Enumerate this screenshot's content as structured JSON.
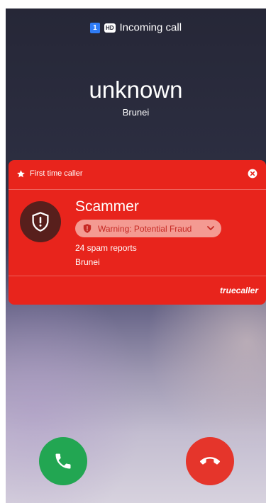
{
  "status_bar": {
    "sim_slot": "1",
    "hd_badge": "HD",
    "status_text": "Incoming call"
  },
  "caller": {
    "name": "unknown",
    "location": "Brunei"
  },
  "truecaller_card": {
    "header_label": "First time caller",
    "title": "Scammer",
    "warning_label": "Warning: Potential Fraud",
    "spam_reports": "24 spam reports",
    "location": "Brunei",
    "brand": "truecaller",
    "colors": {
      "card_background": "#e8241c",
      "shield_circle": "#581f1c",
      "warning_pill": "#f49a92"
    }
  },
  "actions": {
    "accept_icon": "phone-icon",
    "decline_icon": "phone-hangup-icon",
    "accept_color": "#22a652",
    "decline_color": "#e5352b"
  }
}
